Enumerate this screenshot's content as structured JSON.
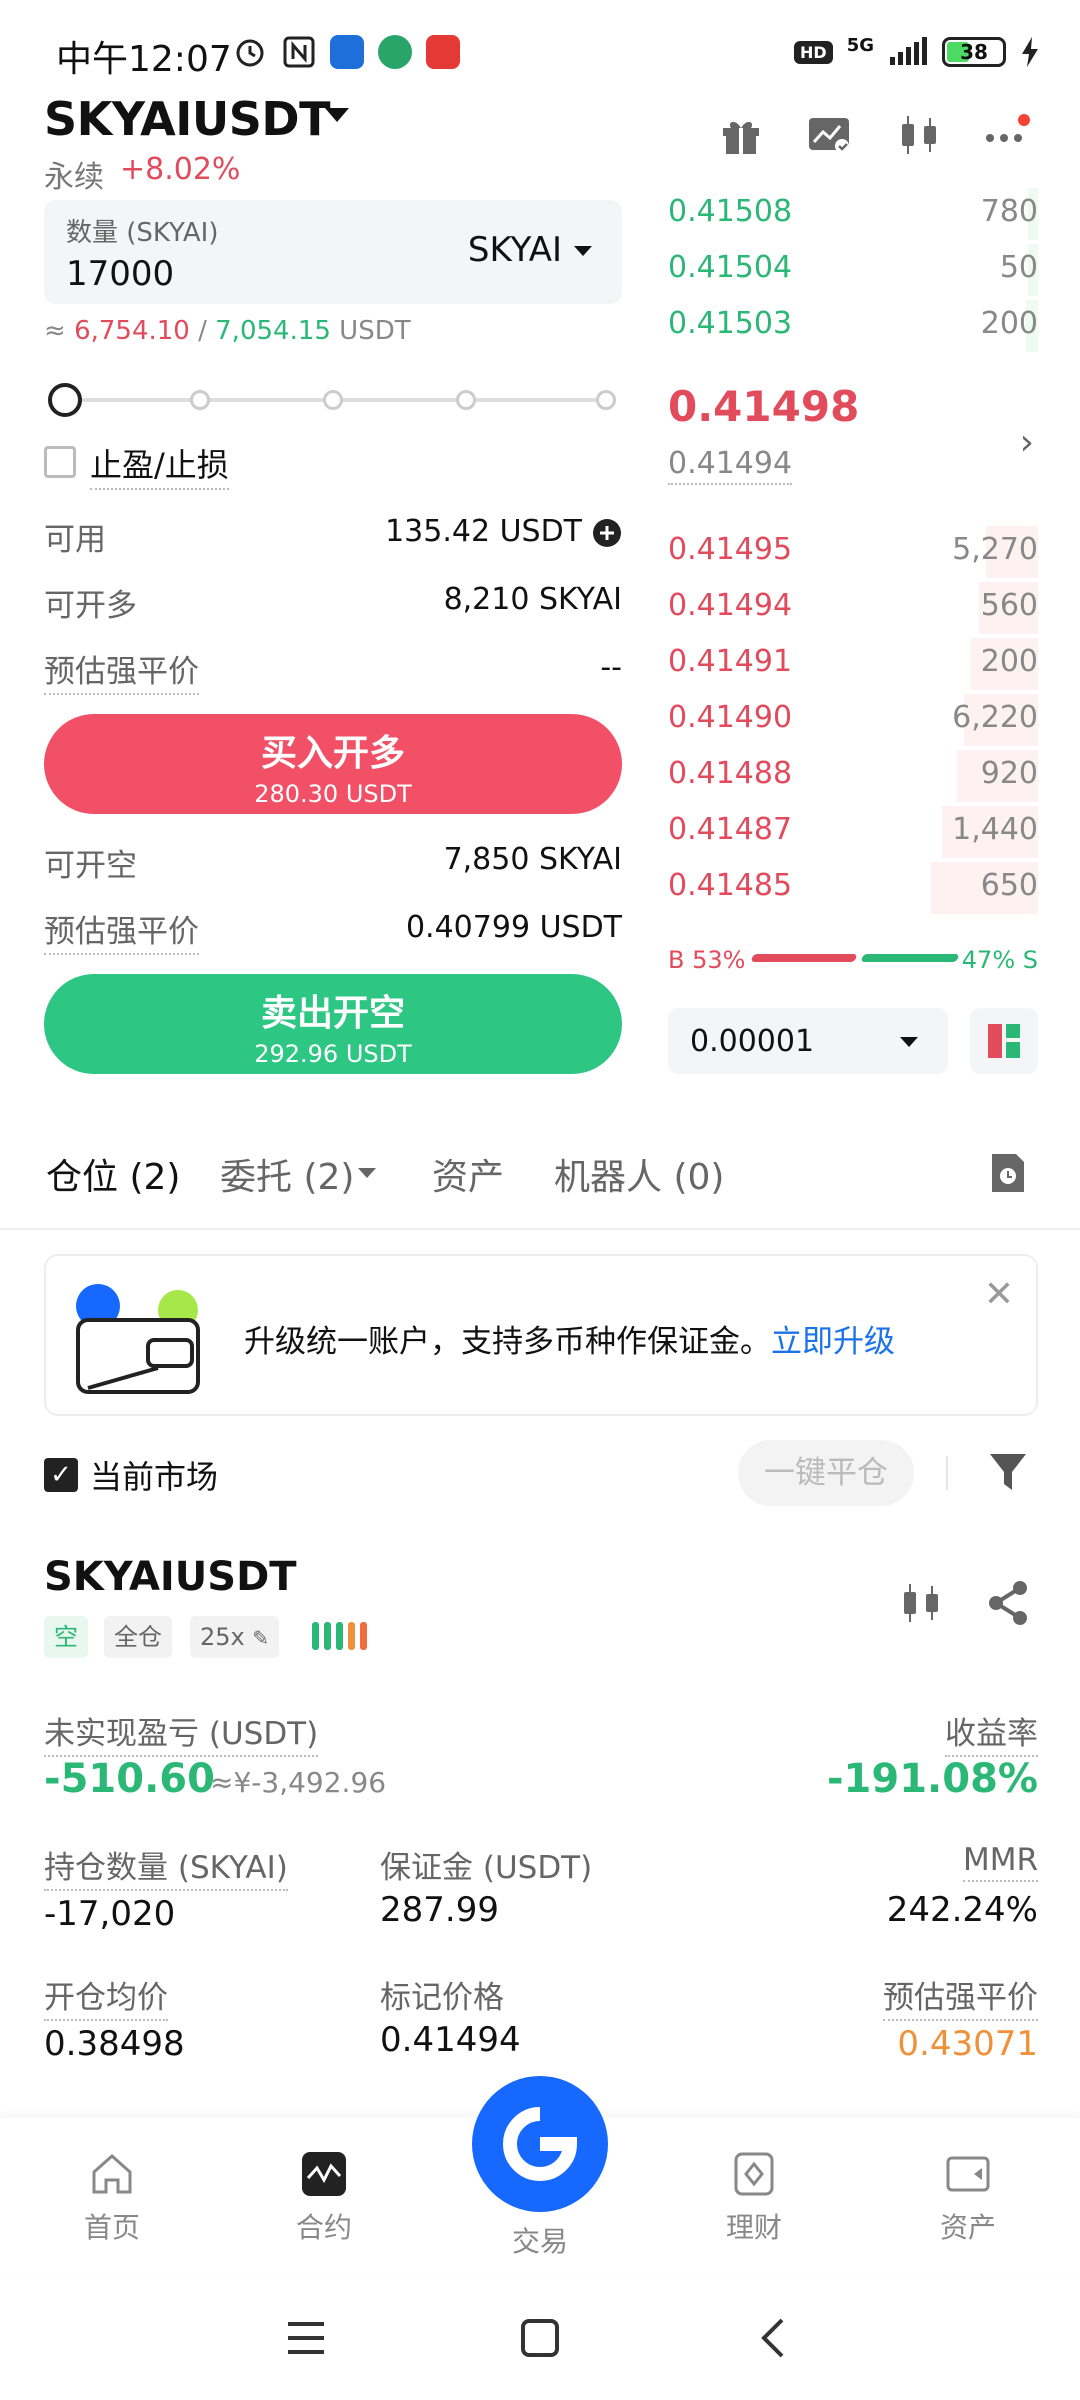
{
  "status_bar": {
    "time": "中午12:07",
    "network": "5G",
    "battery": "38"
  },
  "header": {
    "pair": "SKYAIUSDT",
    "market_type": "永续",
    "change": "+8.02%"
  },
  "order_form": {
    "qty_label": "数量 (SKYAI)",
    "qty_value": "17000",
    "qty_unit": "SKYAI",
    "approx_prefix": "≈ ",
    "approx_buy": "6,754.10",
    "approx_sep": " / ",
    "approx_sell": "7,054.15",
    "approx_unit": " USDT",
    "tpsl_label": "止盈/止损",
    "available_label": "可用",
    "available_value": "135.42  USDT",
    "can_long_label": "可开多",
    "can_long_value": "8,210 SKYAI",
    "liq_label_long": "预估强平价",
    "liq_value_long": "--",
    "buy_label": "买入开多",
    "buy_sub": "280.30 USDT",
    "can_short_label": "可开空",
    "can_short_value": "7,850 SKYAI",
    "liq_label_short": "预估强平价",
    "liq_value_short": "0.40799 USDT",
    "sell_label": "卖出开空",
    "sell_sub": "292.96 USDT"
  },
  "order_book": {
    "asks_green": [
      {
        "price": "0.41508",
        "qty": "780"
      },
      {
        "price": "0.41504",
        "qty": "50"
      },
      {
        "price": "0.41503",
        "qty": "200"
      }
    ],
    "last_price": "0.41498",
    "mark_price": "0.41494",
    "bids_red": [
      {
        "price": "0.41495",
        "qty": "5,270",
        "depth": 0.14
      },
      {
        "price": "0.41494",
        "qty": "560",
        "depth": 0.16
      },
      {
        "price": "0.41491",
        "qty": "200",
        "depth": 0.18
      },
      {
        "price": "0.41490",
        "qty": "6,220",
        "depth": 0.2
      },
      {
        "price": "0.41488",
        "qty": "920",
        "depth": 0.22
      },
      {
        "price": "0.41487",
        "qty": "1,440",
        "depth": 0.26
      },
      {
        "price": "0.41485",
        "qty": "650",
        "depth": 0.29
      }
    ],
    "buy_ratio": "B 53%",
    "sell_ratio": "47% S",
    "tick_size": "0.00001"
  },
  "tabs": [
    {
      "label": "仓位 (2)"
    },
    {
      "label": "委托 (2)"
    },
    {
      "label": "资产"
    },
    {
      "label": "机器人 (0)"
    }
  ],
  "banner": {
    "text": "升级统一账户，支持多币种作保证金。",
    "link": "立即升级"
  },
  "filters": {
    "current_market": "当前市场",
    "close_all": "一键平仓"
  },
  "position": {
    "symbol": "SKYAIUSDT",
    "side_tag": "空",
    "margin_tag": "全仓",
    "leverage_tag": "25x",
    "unrealized_label": "未实现盈亏 (USDT)",
    "unrealized_value": "-510.60",
    "unrealized_cny": "≈¥-3,492.96",
    "roe_label": "收益率",
    "roe_value": "-191.08%",
    "size_label": "持仓数量 (SKYAI)",
    "size_value": "-17,020",
    "margin_label": "保证金 (USDT)",
    "margin_value": "287.99",
    "mmr_label": "MMR",
    "mmr_value": "242.24%",
    "entry_label": "开仓均价",
    "entry_value": "0.38498",
    "mark_label": "标记价格",
    "mark_value": "0.41494",
    "liq_label": "预估强平价",
    "liq_value": "0.43071"
  },
  "bottom_nav": [
    {
      "label": "首页"
    },
    {
      "label": "合约"
    },
    {
      "label": "交易"
    },
    {
      "label": "理财"
    },
    {
      "label": "资产"
    }
  ],
  "colors": {
    "red": "#e24b5b",
    "green": "#2bb776",
    "orange": "#f0913a",
    "blue": "#1668ff"
  }
}
